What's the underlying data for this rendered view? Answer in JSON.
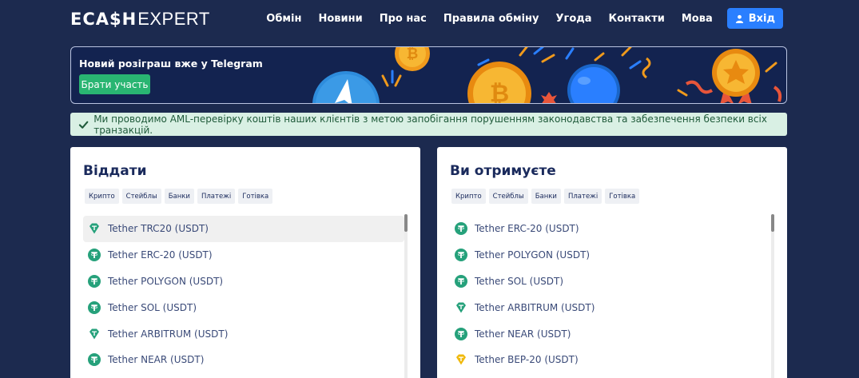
{
  "header": {
    "logo_ecash": "ECA$H",
    "logo_expert": "EXPERT",
    "nav": [
      "Обмін",
      "Новини",
      "Про нас",
      "Правила обміну",
      "Угода",
      "Контакти",
      "Мова"
    ],
    "login_label": "Вхід"
  },
  "banner": {
    "title": "Новий розіграш вже у Telegram",
    "button_label": "Брати участь"
  },
  "alert": {
    "text": "Ми проводимо AML-перевірку коштів наших клієнтів з метою запобігання порушенням законодавства та забезпечення безпеки всіх транзакцій."
  },
  "give": {
    "title": "Віддати",
    "filters": [
      "Крипто",
      "Стейблы",
      "Банки",
      "Платежі",
      "Готівка"
    ],
    "items": [
      {
        "label": "Tether TRC20 (USDT)",
        "icon": "tether-diamond",
        "selected": true
      },
      {
        "label": "Tether ERC-20 (USDT)",
        "icon": "tether"
      },
      {
        "label": "Tether POLYGON (USDT)",
        "icon": "tether"
      },
      {
        "label": "Tether SOL (USDT)",
        "icon": "tether"
      },
      {
        "label": "Tether ARBITRUM (USDT)",
        "icon": "tether-diamond"
      },
      {
        "label": "Tether NEAR (USDT)",
        "icon": "tether"
      }
    ]
  },
  "receive": {
    "title": "Ви отримуєте",
    "filters": [
      "Крипто",
      "Стейблы",
      "Банки",
      "Платежі",
      "Готівка"
    ],
    "items": [
      {
        "label": "Tether ERC-20 (USDT)",
        "icon": "tether"
      },
      {
        "label": "Tether POLYGON (USDT)",
        "icon": "tether"
      },
      {
        "label": "Tether SOL (USDT)",
        "icon": "tether"
      },
      {
        "label": "Tether ARBITRUM (USDT)",
        "icon": "tether-diamond"
      },
      {
        "label": "Tether NEAR (USDT)",
        "icon": "tether"
      },
      {
        "label": "Tether BEP-20 (USDT)",
        "icon": "tether-diamond-gold"
      }
    ]
  },
  "colors": {
    "background": "#1c2a4f",
    "accent_blue": "#2a7fff",
    "accent_green": "#29b572",
    "tether_green": "#26a17b",
    "bep20_gold": "#f0b90b"
  }
}
